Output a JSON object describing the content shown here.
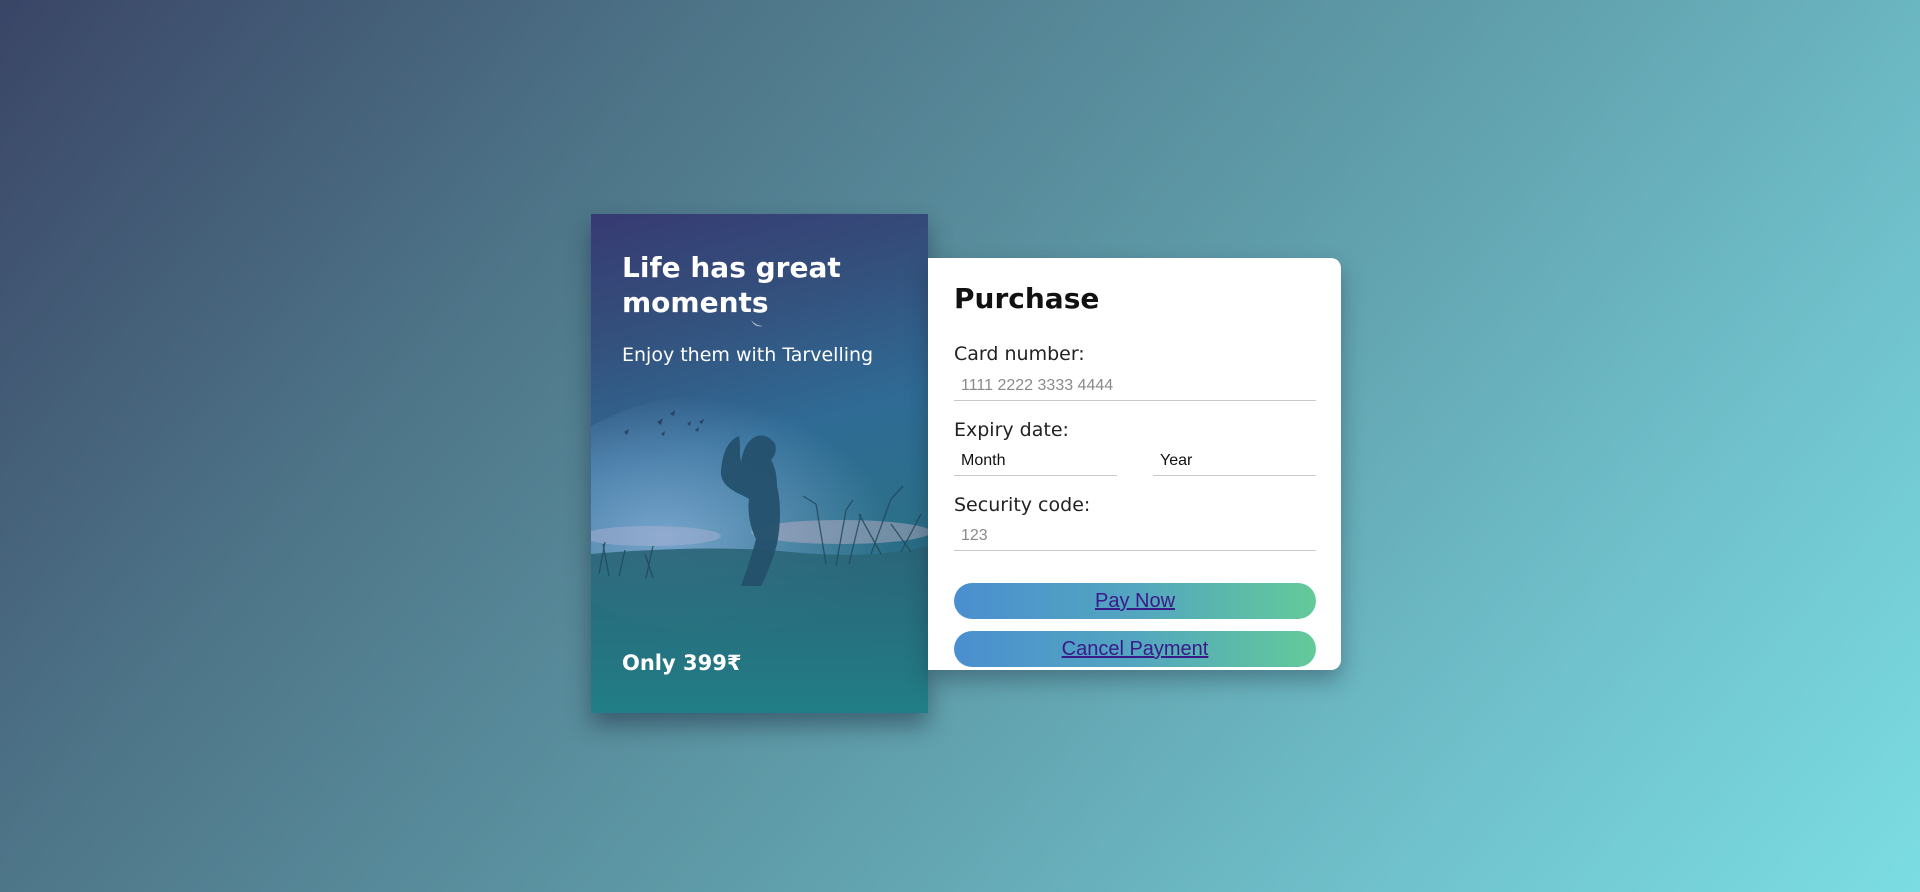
{
  "promo": {
    "title": "Life has great moments",
    "subtitle": "Enjoy them with Tarvelling",
    "price": "Only 399₹"
  },
  "purchase": {
    "title": "Purchase",
    "card_number": {
      "label": "Card number:",
      "placeholder": "1111 2222 3333 4444"
    },
    "expiry": {
      "label": "Expiry date:",
      "month": "Month",
      "year": "Year"
    },
    "security": {
      "label": "Security code:",
      "placeholder": "123"
    },
    "pay_label": "Pay Now",
    "cancel_label": "Cancel Payment"
  },
  "colors": {
    "button_gradient_start": "#4a8fd0",
    "button_gradient_end": "#63ca99",
    "button_text": "#3a1a8a"
  }
}
